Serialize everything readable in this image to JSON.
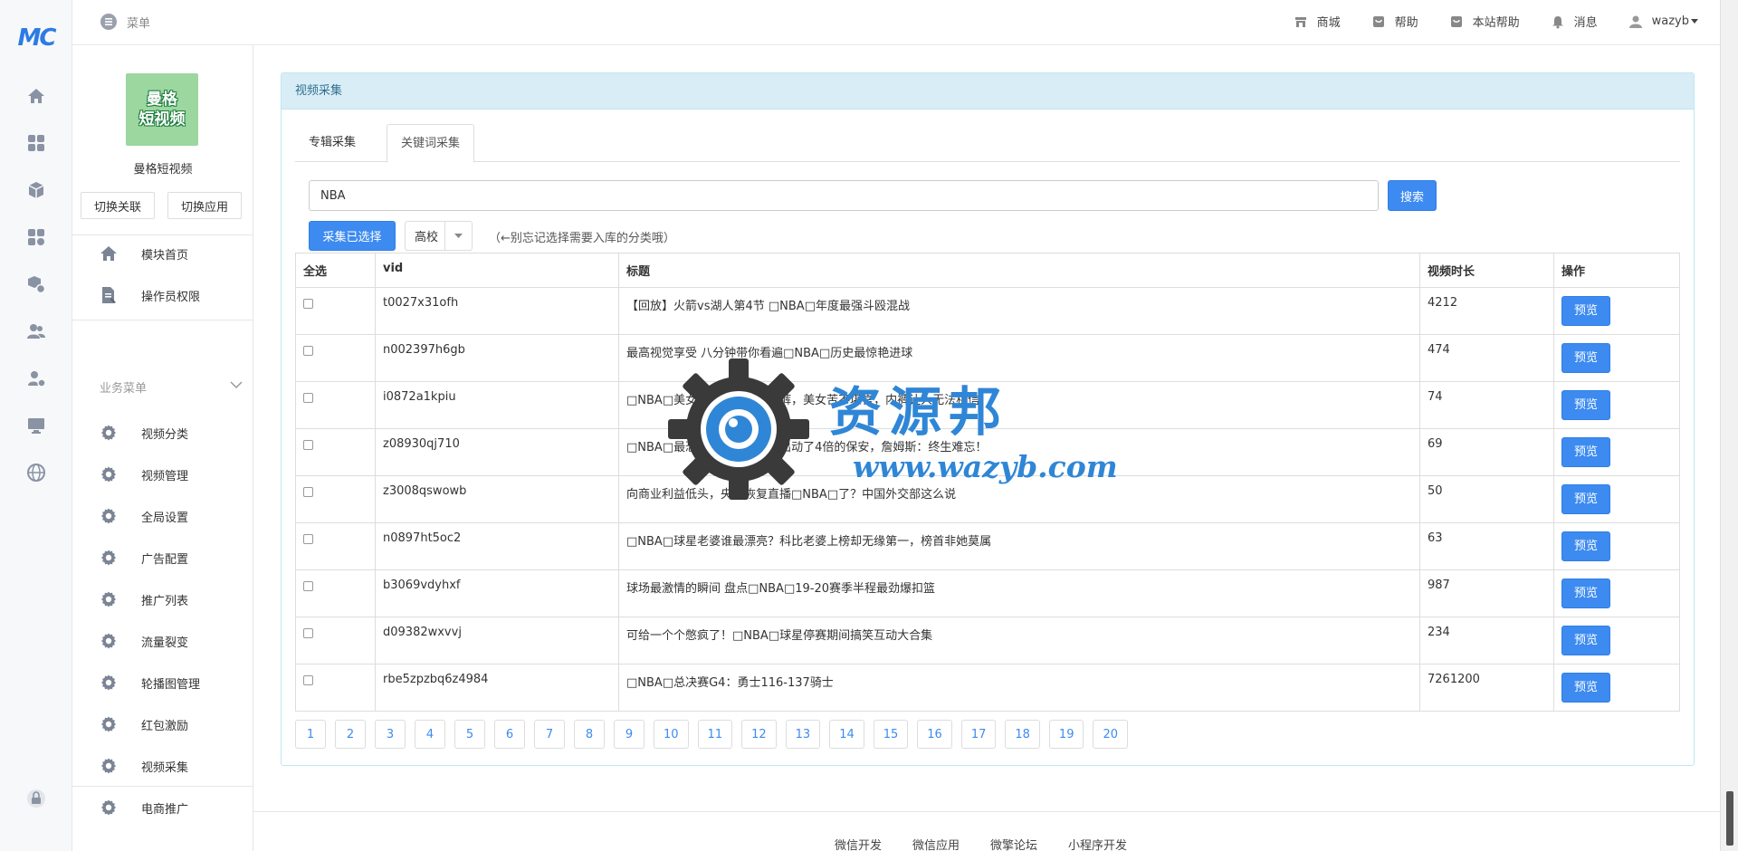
{
  "rail": {
    "logo": "MC",
    "icons": [
      "home-icon",
      "apps-icon",
      "cube-icon",
      "widgets-icon",
      "package-settings-icon",
      "users-icon",
      "user-settings-icon",
      "monitor-icon",
      "globe-icon",
      "lock-icon"
    ]
  },
  "topbar": {
    "menu_label": "菜单",
    "links": [
      {
        "label": "商城",
        "icon": "shop-icon"
      },
      {
        "label": "帮助",
        "icon": "help-icon"
      },
      {
        "label": "本站帮助",
        "icon": "site-help-icon"
      },
      {
        "label": "消息",
        "icon": "bell-icon"
      }
    ],
    "user": "wazyb"
  },
  "sidebar": {
    "app_thumb_text_1": "曼格",
    "app_thumb_text_2": "短视频",
    "app_name": "曼格短视频",
    "switch_link_label": "切换关联",
    "switch_app_label": "切换应用",
    "top_items": [
      {
        "label": "模块首页",
        "icon": "home-icon"
      },
      {
        "label": "操作员权限",
        "icon": "document-edit-icon"
      }
    ],
    "group_label": "业务菜单",
    "items": [
      {
        "label": "视频分类"
      },
      {
        "label": "视频管理"
      },
      {
        "label": "全局设置"
      },
      {
        "label": "广告配置"
      },
      {
        "label": "推广列表"
      },
      {
        "label": "流量裂变"
      },
      {
        "label": "轮播图管理"
      },
      {
        "label": "红包激励"
      },
      {
        "label": "视频采集"
      },
      {
        "label": "电商推广"
      }
    ]
  },
  "panel": {
    "title": "视频采集",
    "tabs": [
      "专辑采集",
      "关键词采集"
    ],
    "active_tab": 1,
    "search_value": "NBA",
    "search_button": "搜索",
    "collect_button": "采集已选择",
    "category_selected": "高校",
    "hint": "（←别忘记选择需要入库的分类哦）",
    "columns": [
      "全选",
      "vid",
      "标题",
      "视频时长",
      "操作"
    ],
    "preview_label": "预览",
    "rows": [
      {
        "vid": "t0027x31ofh",
        "title": "【回放】火箭vs湖人第4节 □NBA□年度最强斗殴混战",
        "duration": "4212"
      },
      {
        "vid": "n002397h6gb",
        "title": "最高视觉享受 八分钟带你看遍□NBA□历史最惊艳进球",
        "duration": "474"
      },
      {
        "vid": "i0872a1kpiu",
        "title": "□NBA□美女啦啦队被扯掉短裤，美女苦不堪言，内裤让人无法相信",
        "duration": "74"
      },
      {
        "vid": "z08930qj710",
        "title": "□NBA□最恐怖的一次冲突，出动了4倍的保安，詹姆斯：终生难忘！",
        "duration": "69"
      },
      {
        "vid": "z3008qswowb",
        "title": "向商业利益低头，央视恢复直播□NBA□了？中国外交部这么说",
        "duration": "50"
      },
      {
        "vid": "n0897ht5oc2",
        "title": "□NBA□球星老婆谁最漂亮？科比老婆上榜却无缘第一，榜首非她莫属",
        "duration": "63"
      },
      {
        "vid": "b3069vdyhxf",
        "title": "球场最激情的瞬间 盘点□NBA□19-20赛季半程最劲爆扣篮",
        "duration": "987"
      },
      {
        "vid": "d09382wxvvj",
        "title": "可给一个个憋疯了！□NBA□球星停赛期间搞笑互动大合集",
        "duration": "234"
      },
      {
        "vid": "rbe5zpzbq6z4984",
        "title": "□NBA□总决赛G4：勇士116-137骑士",
        "duration": "7261200"
      }
    ],
    "pages": [
      "1",
      "2",
      "3",
      "4",
      "5",
      "6",
      "7",
      "8",
      "9",
      "10",
      "11",
      "12",
      "13",
      "14",
      "15",
      "16",
      "17",
      "18",
      "19",
      "20"
    ]
  },
  "footer": {
    "links": [
      "微信开发",
      "微信应用",
      "微擎论坛",
      "小程序开发"
    ]
  },
  "watermark": {
    "title": "资源邦",
    "url": "www.wazyb.com"
  },
  "colors": {
    "primary": "#3d8bf0",
    "panel_header_bg": "#d9edf7",
    "panel_header_text": "#31708f",
    "logo": "#2d7be5"
  }
}
